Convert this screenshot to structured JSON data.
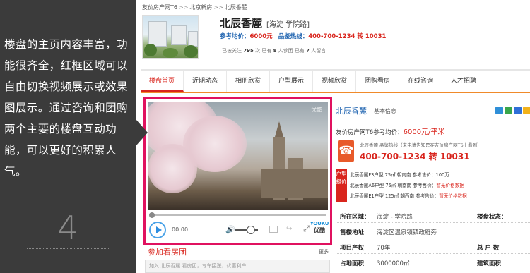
{
  "left_panel": {
    "caption": "楼盘的主页内容丰富，功能很齐全，红框区域可以自由切换视频展示或效果图展示。通过咨询和团购两个主要的楼盘互动功能，可以更好的积累人气。",
    "step_number": "4"
  },
  "breadcrumb": {
    "items": [
      "友价房产网T6",
      "北京新房",
      "北辰香麓"
    ],
    "separator": ">>"
  },
  "project": {
    "name": "北辰香麓",
    "location": "[海淀 学院路]",
    "ref_price_label": "参考均价：",
    "ref_price_value": "6000元",
    "hotline_label": "品鉴热线：",
    "hotline_value": "400-700-1234 转 10031",
    "stats": {
      "prefix": "已被关注",
      "follow_count": "795",
      "follow_unit": "次 已有",
      "visit_count": "8",
      "visit_unit": "人参团 已有",
      "msg_count": "7",
      "msg_unit": "人留言"
    }
  },
  "nav": {
    "tabs": [
      "楼盘首页",
      "近期动态",
      "相册欣赏",
      "户型展示",
      "视频欣赏",
      "团购看房",
      "在线咨询",
      "人才招聘"
    ],
    "active_index": 0
  },
  "player": {
    "time": "00:00",
    "watermark": "优酷",
    "brand_en": "YOUKU",
    "brand_zh": "优酷"
  },
  "group_buy": {
    "title": "参加看房团",
    "more": "更多",
    "placeholder": "加入 北辰香麓 看房团，专车接送，优惠利产"
  },
  "info": {
    "title": "北辰香麓",
    "subtitle": "基本信息",
    "ref_price_label": "友价房产网T6参考均价：",
    "ref_price_value": "6000元/平米",
    "hotline_note": "北辰香麓  品鉴热线（来电请告知是在友价房产网T6上看到）",
    "hotline_number": "400-700-1234 转 10031",
    "units_tag": "户型报价",
    "units": [
      {
        "name": "北辰香麓F3户型",
        "area": "75㎡",
        "orient": "朝南南",
        "price_label": "参考售价：",
        "price": "100万",
        "price_red": false
      },
      {
        "name": "北辰香麓A6户型",
        "area": "75㎡",
        "orient": "朝南南",
        "price_label": "参考售价：",
        "price": "暂无价格数据",
        "price_red": true
      },
      {
        "name": "北辰香麓E1户型",
        "area": "125㎡",
        "orient": "朝西南",
        "price_label": "参考售价：",
        "price": "暂无价格数据",
        "price_red": true
      }
    ],
    "table": [
      {
        "k": "所在区域：",
        "v": "海淀 - 学院路",
        "k2": "楼盘状态：",
        "v2": ""
      },
      {
        "k": "售楼地址",
        "v": "海淀区温泉镇镇政府旁",
        "k2": "",
        "v2": ""
      },
      {
        "k": "项目产权",
        "v": "70年",
        "k2": "总 户 数",
        "v2": ""
      },
      {
        "k": "占地面积",
        "v": "3000000㎡",
        "k2": "建筑面积",
        "v2": ""
      }
    ]
  }
}
